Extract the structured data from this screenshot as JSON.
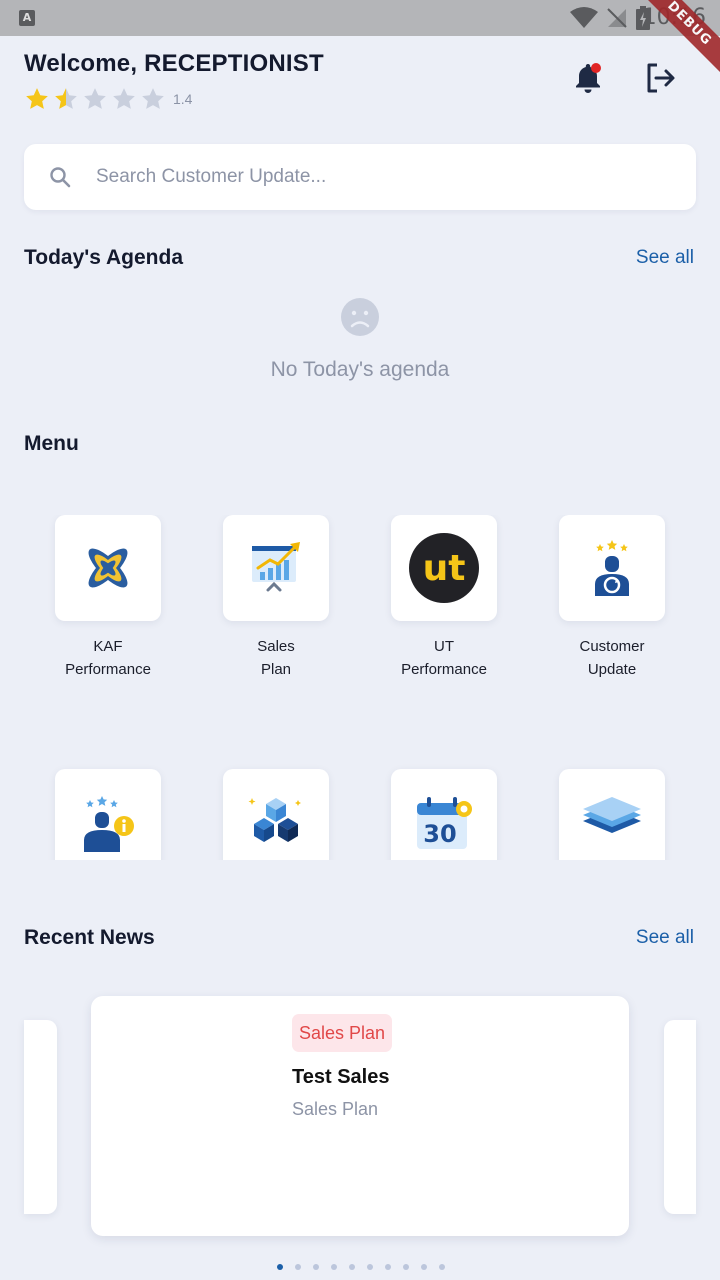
{
  "status_bar": {
    "time": "10:16",
    "debug_banner": "DEBUG",
    "a_badge": "A"
  },
  "header": {
    "welcome_text": "Welcome, RECEPTIONIST",
    "rating_value": "1.4",
    "rating": 1.4,
    "rating_max": 5
  },
  "search": {
    "placeholder": "Search Customer Update..."
  },
  "agenda": {
    "title": "Today's Agenda",
    "see_all": "See all",
    "empty_text": "No Today's agenda"
  },
  "menu": {
    "title": "Menu",
    "items": [
      {
        "label": "KAF\nPerformance",
        "icon": "kaf-logo-icon"
      },
      {
        "label": "Sales\nPlan",
        "icon": "sales-chart-icon"
      },
      {
        "label": "UT\nPerformance",
        "icon": "ut-logo-icon"
      },
      {
        "label": "Customer\nUpdate",
        "icon": "customer-update-icon"
      },
      {
        "label": "",
        "icon": "customer-info-icon"
      },
      {
        "label": "",
        "icon": "cubes-icon"
      },
      {
        "label": "",
        "icon": "calendar-30-icon"
      },
      {
        "label": "",
        "icon": "layers-icon"
      }
    ]
  },
  "calendar_day": "30",
  "ut_logo_text": "ut",
  "news": {
    "title": "Recent News",
    "see_all": "See all",
    "card": {
      "badge": "Sales Plan",
      "title": "Test Sales",
      "subtitle": "Sales Plan"
    },
    "page_count": 10,
    "active_page": 0
  },
  "colors": {
    "accent": "#1b5fa8",
    "star": "#f5c518",
    "badge_bg": "#fde6ea",
    "badge_text": "#e14848",
    "background": "#eceff7"
  }
}
